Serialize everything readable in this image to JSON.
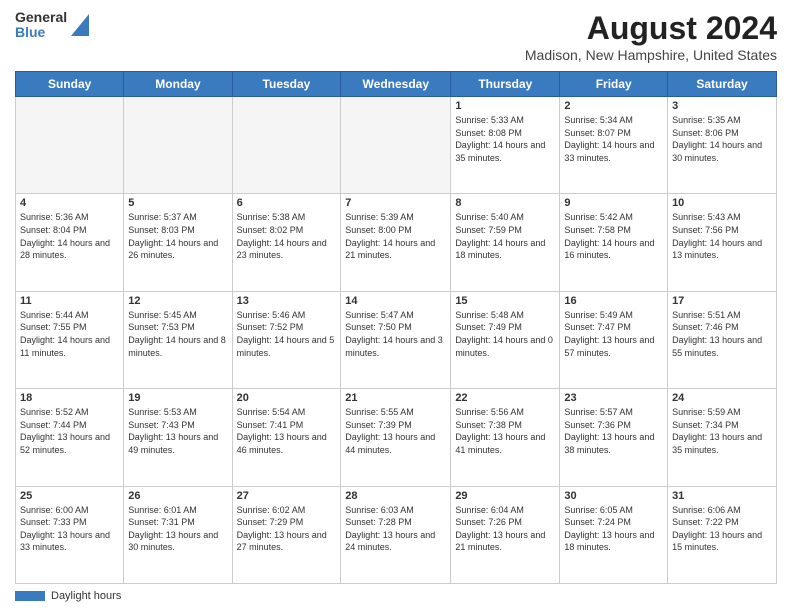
{
  "header": {
    "logo_general": "General",
    "logo_blue": "Blue",
    "main_title": "August 2024",
    "subtitle": "Madison, New Hampshire, United States"
  },
  "footer": {
    "label": "Daylight hours"
  },
  "columns": [
    "Sunday",
    "Monday",
    "Tuesday",
    "Wednesday",
    "Thursday",
    "Friday",
    "Saturday"
  ],
  "weeks": [
    [
      {
        "day": "",
        "info": ""
      },
      {
        "day": "",
        "info": ""
      },
      {
        "day": "",
        "info": ""
      },
      {
        "day": "",
        "info": ""
      },
      {
        "day": "1",
        "info": "Sunrise: 5:33 AM\nSunset: 8:08 PM\nDaylight: 14 hours and 35 minutes."
      },
      {
        "day": "2",
        "info": "Sunrise: 5:34 AM\nSunset: 8:07 PM\nDaylight: 14 hours and 33 minutes."
      },
      {
        "day": "3",
        "info": "Sunrise: 5:35 AM\nSunset: 8:06 PM\nDaylight: 14 hours and 30 minutes."
      }
    ],
    [
      {
        "day": "4",
        "info": "Sunrise: 5:36 AM\nSunset: 8:04 PM\nDaylight: 14 hours and 28 minutes."
      },
      {
        "day": "5",
        "info": "Sunrise: 5:37 AM\nSunset: 8:03 PM\nDaylight: 14 hours and 26 minutes."
      },
      {
        "day": "6",
        "info": "Sunrise: 5:38 AM\nSunset: 8:02 PM\nDaylight: 14 hours and 23 minutes."
      },
      {
        "day": "7",
        "info": "Sunrise: 5:39 AM\nSunset: 8:00 PM\nDaylight: 14 hours and 21 minutes."
      },
      {
        "day": "8",
        "info": "Sunrise: 5:40 AM\nSunset: 7:59 PM\nDaylight: 14 hours and 18 minutes."
      },
      {
        "day": "9",
        "info": "Sunrise: 5:42 AM\nSunset: 7:58 PM\nDaylight: 14 hours and 16 minutes."
      },
      {
        "day": "10",
        "info": "Sunrise: 5:43 AM\nSunset: 7:56 PM\nDaylight: 14 hours and 13 minutes."
      }
    ],
    [
      {
        "day": "11",
        "info": "Sunrise: 5:44 AM\nSunset: 7:55 PM\nDaylight: 14 hours and 11 minutes."
      },
      {
        "day": "12",
        "info": "Sunrise: 5:45 AM\nSunset: 7:53 PM\nDaylight: 14 hours and 8 minutes."
      },
      {
        "day": "13",
        "info": "Sunrise: 5:46 AM\nSunset: 7:52 PM\nDaylight: 14 hours and 5 minutes."
      },
      {
        "day": "14",
        "info": "Sunrise: 5:47 AM\nSunset: 7:50 PM\nDaylight: 14 hours and 3 minutes."
      },
      {
        "day": "15",
        "info": "Sunrise: 5:48 AM\nSunset: 7:49 PM\nDaylight: 14 hours and 0 minutes."
      },
      {
        "day": "16",
        "info": "Sunrise: 5:49 AM\nSunset: 7:47 PM\nDaylight: 13 hours and 57 minutes."
      },
      {
        "day": "17",
        "info": "Sunrise: 5:51 AM\nSunset: 7:46 PM\nDaylight: 13 hours and 55 minutes."
      }
    ],
    [
      {
        "day": "18",
        "info": "Sunrise: 5:52 AM\nSunset: 7:44 PM\nDaylight: 13 hours and 52 minutes."
      },
      {
        "day": "19",
        "info": "Sunrise: 5:53 AM\nSunset: 7:43 PM\nDaylight: 13 hours and 49 minutes."
      },
      {
        "day": "20",
        "info": "Sunrise: 5:54 AM\nSunset: 7:41 PM\nDaylight: 13 hours and 46 minutes."
      },
      {
        "day": "21",
        "info": "Sunrise: 5:55 AM\nSunset: 7:39 PM\nDaylight: 13 hours and 44 minutes."
      },
      {
        "day": "22",
        "info": "Sunrise: 5:56 AM\nSunset: 7:38 PM\nDaylight: 13 hours and 41 minutes."
      },
      {
        "day": "23",
        "info": "Sunrise: 5:57 AM\nSunset: 7:36 PM\nDaylight: 13 hours and 38 minutes."
      },
      {
        "day": "24",
        "info": "Sunrise: 5:59 AM\nSunset: 7:34 PM\nDaylight: 13 hours and 35 minutes."
      }
    ],
    [
      {
        "day": "25",
        "info": "Sunrise: 6:00 AM\nSunset: 7:33 PM\nDaylight: 13 hours and 33 minutes."
      },
      {
        "day": "26",
        "info": "Sunrise: 6:01 AM\nSunset: 7:31 PM\nDaylight: 13 hours and 30 minutes."
      },
      {
        "day": "27",
        "info": "Sunrise: 6:02 AM\nSunset: 7:29 PM\nDaylight: 13 hours and 27 minutes."
      },
      {
        "day": "28",
        "info": "Sunrise: 6:03 AM\nSunset: 7:28 PM\nDaylight: 13 hours and 24 minutes."
      },
      {
        "day": "29",
        "info": "Sunrise: 6:04 AM\nSunset: 7:26 PM\nDaylight: 13 hours and 21 minutes."
      },
      {
        "day": "30",
        "info": "Sunrise: 6:05 AM\nSunset: 7:24 PM\nDaylight: 13 hours and 18 minutes."
      },
      {
        "day": "31",
        "info": "Sunrise: 6:06 AM\nSunset: 7:22 PM\nDaylight: 13 hours and 15 minutes."
      }
    ]
  ]
}
